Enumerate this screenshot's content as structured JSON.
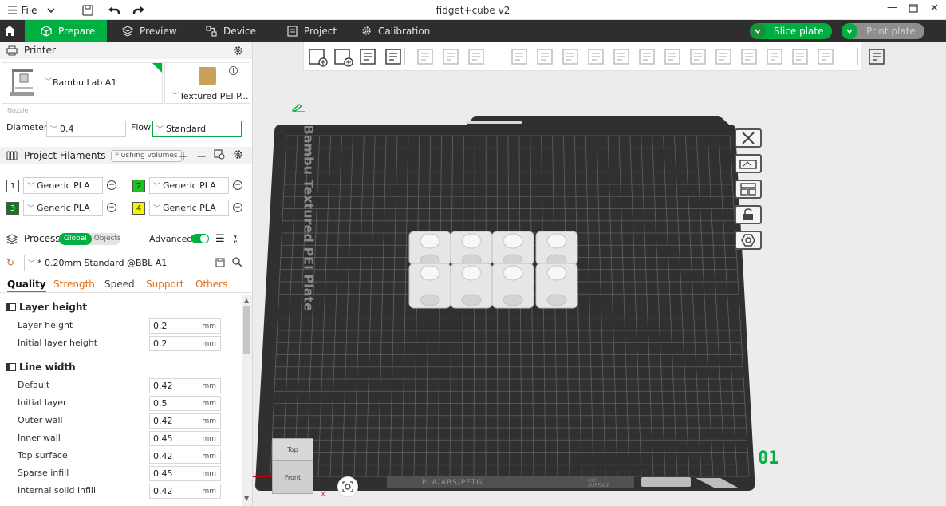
{
  "titlebar": {
    "menu_label": "File",
    "title": "fidget+cube v2"
  },
  "tabs": [
    {
      "label": "Prepare",
      "icon": "cube-icon",
      "active": true
    },
    {
      "label": "Preview",
      "icon": "layers-icon"
    },
    {
      "label": "Device",
      "icon": "device-icon"
    },
    {
      "label": "Project",
      "icon": "document-icon"
    },
    {
      "label": "Calibration",
      "icon": "gear-icon"
    }
  ],
  "actions": {
    "slice_label": "Slice plate",
    "print_label": "Print plate"
  },
  "printer": {
    "section_title": "Printer",
    "printer_name": "Bambu Lab A1",
    "plate_name": "Textured PEI P...",
    "nozzle_label": "Nozzle",
    "diameter_label": "Diameter",
    "diameter_value": "0.4",
    "flow_label": "Flow",
    "flow_value": "Standard"
  },
  "filaments": {
    "section_title": "Project Filaments",
    "flushing_label": "Flushing volumes",
    "items": [
      {
        "num": "1",
        "name": "Generic PLA",
        "color": "#ffffff"
      },
      {
        "num": "2",
        "name": "Generic PLA",
        "color": "#19c31c"
      },
      {
        "num": "3",
        "name": "Generic PLA",
        "color": "#0d7a1a"
      },
      {
        "num": "4",
        "name": "Generic PLA",
        "color": "#f5f500"
      }
    ]
  },
  "process": {
    "section_title": "Process",
    "toggle_global": "Global",
    "toggle_objects": "Objects",
    "advanced_label": "Advanced",
    "preset": "* 0.20mm Standard @BBL A1",
    "tabs": [
      "Quality",
      "Strength",
      "Speed",
      "Support",
      "Others"
    ],
    "groups": [
      {
        "title": "Layer height",
        "params": [
          {
            "label": "Layer height",
            "value": "0.2",
            "unit": "mm"
          },
          {
            "label": "Initial layer height",
            "value": "0.2",
            "unit": "mm"
          }
        ]
      },
      {
        "title": "Line width",
        "params": [
          {
            "label": "Default",
            "value": "0.42",
            "unit": "mm"
          },
          {
            "label": "Initial layer",
            "value": "0.5",
            "unit": "mm"
          },
          {
            "label": "Outer wall",
            "value": "0.42",
            "unit": "mm"
          },
          {
            "label": "Inner wall",
            "value": "0.45",
            "unit": "mm"
          },
          {
            "label": "Top surface",
            "value": "0.42",
            "unit": "mm"
          },
          {
            "label": "Sparse infill",
            "value": "0.45",
            "unit": "mm"
          },
          {
            "label": "Internal solid infill",
            "value": "0.42",
            "unit": "mm"
          }
        ]
      }
    ]
  },
  "plate": {
    "bed_label": "Bambu Textured PEI Plate",
    "plate_number": "01",
    "bottom_text": "PLA/ABS/PETG",
    "hot_surface": "HOT SURFACE"
  },
  "viewcube": {
    "top_label": "Top",
    "front_label": "Front"
  },
  "colors": {
    "accent": "#00ae42",
    "tabbar": "#2e2e2e",
    "bed": "#3a3a3a"
  }
}
